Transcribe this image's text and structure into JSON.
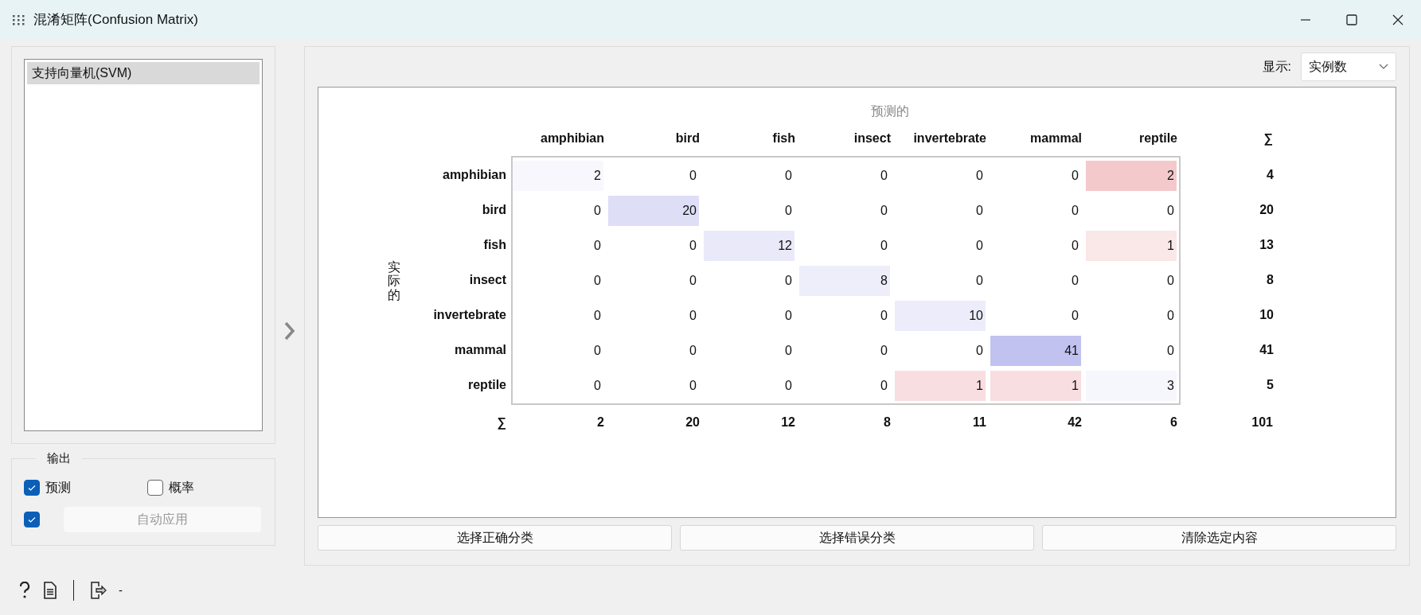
{
  "window": {
    "title": "混淆矩阵(Confusion Matrix)"
  },
  "learners": [
    {
      "label": "支持向量机(SVM)",
      "selected": true
    }
  ],
  "output": {
    "title": "输出",
    "options": [
      {
        "label": "预测",
        "checked": true
      },
      {
        "label": "概率",
        "checked": false
      }
    ],
    "auto_apply": {
      "checked": true,
      "label": "自动应用",
      "disabled": true
    }
  },
  "display": {
    "label": "显示:",
    "value": "实例数"
  },
  "matrix": {
    "predicted_label": "预测的",
    "actual_label": "实际的",
    "sum_header": "∑",
    "sum_footer": "∑",
    "columns": [
      "amphibian",
      "bird",
      "fish",
      "insect",
      "invertebrate",
      "mammal",
      "reptile"
    ],
    "rows": [
      {
        "label": "amphibian",
        "values": [
          "2",
          "0",
          "0",
          "0",
          "0",
          "0",
          "2"
        ],
        "total": "4"
      },
      {
        "label": "bird",
        "values": [
          "0",
          "20",
          "0",
          "0",
          "0",
          "0",
          "0"
        ],
        "total": "20"
      },
      {
        "label": "fish",
        "values": [
          "0",
          "0",
          "12",
          "0",
          "0",
          "0",
          "1"
        ],
        "total": "13"
      },
      {
        "label": "insect",
        "values": [
          "0",
          "0",
          "0",
          "8",
          "0",
          "0",
          "0"
        ],
        "total": "8"
      },
      {
        "label": "invertebrate",
        "values": [
          "0",
          "0",
          "0",
          "0",
          "10",
          "0",
          "0"
        ],
        "total": "10"
      },
      {
        "label": "mammal",
        "values": [
          "0",
          "0",
          "0",
          "0",
          "0",
          "41",
          "0"
        ],
        "total": "41"
      },
      {
        "label": "reptile",
        "values": [
          "0",
          "0",
          "0",
          "0",
          "1",
          "1",
          "3"
        ],
        "total": "5"
      }
    ],
    "column_totals": [
      "2",
      "20",
      "12",
      "8",
      "11",
      "42",
      "6"
    ],
    "grand_total": "101"
  },
  "buttons": [
    "选择正确分类",
    "选择错误分类",
    "清除选定内容"
  ],
  "status": {
    "text": "-"
  }
}
